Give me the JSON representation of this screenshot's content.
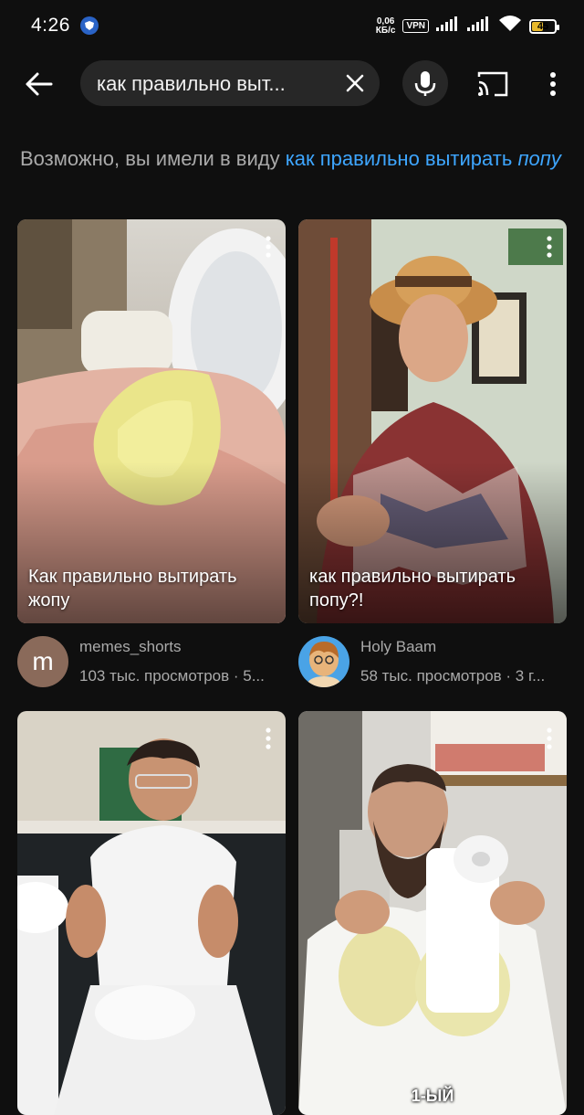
{
  "status_bar": {
    "time": "4:26",
    "speed_value": "0,06",
    "speed_unit": "КБ/с",
    "vpn": "VPN",
    "battery": "45"
  },
  "search": {
    "query": "как правильно выт..."
  },
  "suggestion": {
    "prefix": "Возможно, вы имели в виду ",
    "link_plain": "как правильно вытирать ",
    "link_italic": "попу"
  },
  "videos": [
    {
      "title": "Как правильно вытирать жопу",
      "channel": "memes_shorts",
      "avatar_letter": "m",
      "views": "103 тыс. просмотров · 5..."
    },
    {
      "title": "как правильно вытирать попу?!",
      "channel": "Holy Baam",
      "views": "58 тыс. просмотров · 3 г..."
    },
    {
      "overlay": ""
    },
    {
      "overlay": "1-ЫЙ"
    }
  ],
  "colors": {
    "background": "#0f0f0f",
    "link": "#3ea6ff",
    "secondary_text": "#aaaaaa",
    "search_bg": "#272727",
    "battery": "#e8b92c"
  },
  "icons": [
    "back-arrow-icon",
    "clear-icon",
    "mic-icon",
    "cast-icon",
    "more-vert-icon",
    "wifi-icon",
    "signal-icon"
  ]
}
